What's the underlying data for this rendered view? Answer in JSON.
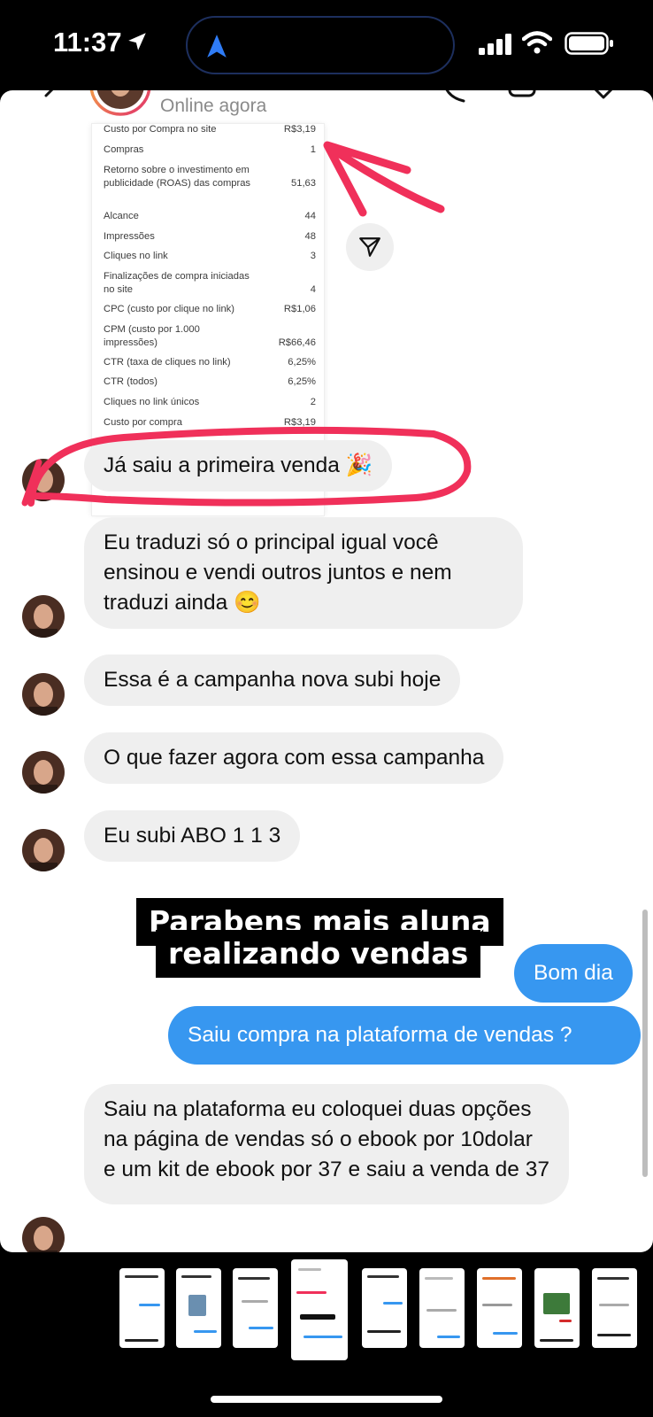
{
  "status_bar": {
    "time": "11:37",
    "icons": [
      "location-arrow-icon",
      "signal-icon",
      "wifi-icon",
      "battery-icon"
    ]
  },
  "chat_header": {
    "status": "Online agora",
    "icons": [
      "back-icon",
      "phone-icon",
      "video-icon",
      "info-icon"
    ]
  },
  "shared_screenshot": {
    "rows": [
      {
        "label": "Custo por Compra no site",
        "value": "R$3,19"
      },
      {
        "label": "Compras",
        "value": "1"
      },
      {
        "label": "Retorno sobre o investimento em publicidade (ROAS) das compras",
        "value": "51,63"
      },
      {
        "label": "Alcance",
        "value": "44"
      },
      {
        "label": "Impressões",
        "value": "48"
      },
      {
        "label": "Cliques no link",
        "value": "3"
      },
      {
        "label": "Finalizações de compra iniciadas no site",
        "value": "4"
      },
      {
        "label": "CPC (custo por clique no link)",
        "value": "R$1,06"
      },
      {
        "label": "CPM (custo por 1.000 impressões)",
        "value": "R$66,46"
      },
      {
        "label": "CTR (taxa de cliques no link)",
        "value": "6,25%"
      },
      {
        "label": "CTR (todos)",
        "value": "6,25%"
      },
      {
        "label": "Cliques no link únicos",
        "value": "2"
      },
      {
        "label": "Custo por compra",
        "value": "R$3,19"
      }
    ]
  },
  "messages": {
    "m1": "Já saiu a primeira venda 🎉",
    "m2": "Eu traduzi só o principal igual você ensinou e vendi outros juntos e nem traduzi ainda 😊",
    "m3": "Essa é a campanha nova subi hoje",
    "m4": "O que fazer agora com essa campanha",
    "m5": "Eu subi ABO 1 1 3",
    "m6": "Bom dia",
    "m7": "Saiu compra na plataforma de vendas ?",
    "m8": "Saiu na plataforma eu coloquei duas opções na página de vendas só o ebook por 10dolar e um kit de ebook por 37 e saiu a venda de 37"
  },
  "caption": {
    "line1": "Parabens mais aluna",
    "line2": "realizando vendas"
  },
  "colors": {
    "incoming_bubble": "#efefef",
    "outgoing_bubble": "#3797f0",
    "annotation": "#f0305a"
  }
}
